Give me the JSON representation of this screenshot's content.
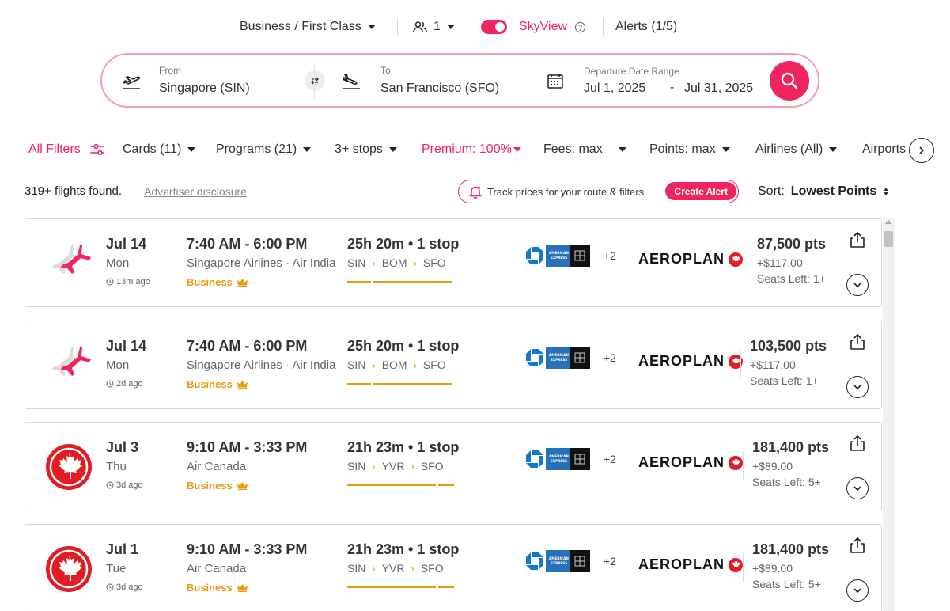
{
  "topbar": {
    "cabin": "Business / First Class",
    "passengers": "1",
    "skyview_label": "SkyView",
    "alerts": "Alerts (1/5)"
  },
  "search": {
    "from_label": "From",
    "from_value": "Singapore (SIN)",
    "to_label": "To",
    "to_value": "San Francisco (SFO)",
    "date_label": "Departure Date Range",
    "date_start": "Jul 1, 2025",
    "date_sep": "-",
    "date_end": "Jul 31, 2025"
  },
  "filters": {
    "all": "All Filters",
    "cards": "Cards (11)",
    "programs": "Programs (21)",
    "stops": "3+ stops",
    "premium": "Premium: 100%",
    "fees": "Fees: max",
    "points": "Points: max",
    "airlines": "Airlines (All)",
    "airports": "Airports"
  },
  "summary": {
    "found": "319+ flights found.",
    "disclosure": "Advertiser disclosure",
    "track_text": "Track prices for your route & filters",
    "create_alert": "Create Alert",
    "sort_label": "Sort:",
    "sort_value": "Lowest Points"
  },
  "colors": {
    "accent": "#f0245f",
    "business": "#e89a10",
    "air_canada_red": "#e31c23",
    "chase_blue": "#117aca",
    "amex_blue": "#2671b9"
  },
  "results": [
    {
      "date": "Jul 14",
      "dow": "Mon",
      "ago": "13m ago",
      "times": "7:40 AM - 6:00 PM",
      "airline": "Singapore Airlines · Air India",
      "cabin": "Business",
      "duration": "25h 20m • 1 stop",
      "route": [
        "SIN",
        "BOM",
        "SFO"
      ],
      "more_cards": "+2",
      "program": "AEROPLAN",
      "points": "87,500 pts",
      "fee": "+$117.00",
      "seats": "Seats Left: 1+",
      "logo": "plane-icon"
    },
    {
      "date": "Jul 14",
      "dow": "Mon",
      "ago": "2d ago",
      "times": "7:40 AM - 6:00 PM",
      "airline": "Singapore Airlines · Air India",
      "cabin": "Business",
      "duration": "25h 20m • 1 stop",
      "route": [
        "SIN",
        "BOM",
        "SFO"
      ],
      "more_cards": "+2",
      "program": "AEROPLAN",
      "points": "103,500 pts",
      "fee": "+$117.00",
      "seats": "Seats Left: 1+",
      "logo": "plane-icon"
    },
    {
      "date": "Jul 3",
      "dow": "Thu",
      "ago": "3d ago",
      "times": "9:10 AM - 3:33 PM",
      "airline": "Air Canada",
      "cabin": "Business",
      "duration": "21h 23m • 1 stop",
      "route": [
        "SIN",
        "YVR",
        "SFO"
      ],
      "more_cards": "+2",
      "program": "AEROPLAN",
      "points": "181,400 pts",
      "fee": "+$89.00",
      "seats": "Seats Left: 5+",
      "logo": "maple-leaf-icon"
    },
    {
      "date": "Jul 1",
      "dow": "Tue",
      "ago": "3d ago",
      "times": "9:10 AM - 3:33 PM",
      "airline": "Air Canada",
      "cabin": "Business",
      "duration": "21h 23m • 1 stop",
      "route": [
        "SIN",
        "YVR",
        "SFO"
      ],
      "more_cards": "+2",
      "program": "AEROPLAN",
      "points": "181,400 pts",
      "fee": "+$89.00",
      "seats": "Seats Left: 5+",
      "logo": "maple-leaf-icon"
    }
  ]
}
